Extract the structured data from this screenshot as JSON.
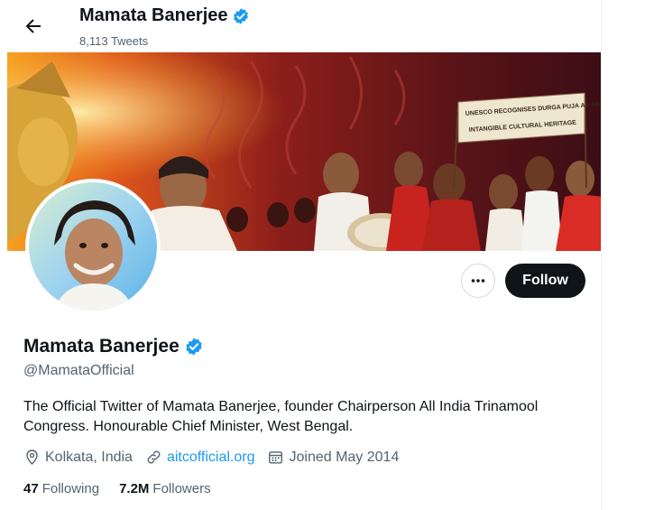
{
  "header": {
    "name": "Mamata Banerjee",
    "tweet_count": "8,113 Tweets"
  },
  "banner": {
    "sign_line1": "UNESCO RECOGNISES DURGA PUJA AS AN",
    "sign_line2": "INTANGIBLE CULTURAL HERITAGE"
  },
  "actions": {
    "follow_label": "Follow"
  },
  "profile": {
    "name": "Mamata Banerjee",
    "handle": "@MamataOfficial",
    "bio": "The Official Twitter of Mamata Banerjee, founder Chairperson All India Trinamool Congress. Honourable Chief Minister, West Bengal.",
    "location": "Kolkata, India",
    "website": "aitcofficial.org",
    "joined": "Joined May 2014"
  },
  "stats": {
    "following_count": "47",
    "following_label": "Following",
    "followers_count": "7.2M",
    "followers_label": "Followers"
  },
  "colors": {
    "accent": "#1d9bf0",
    "text": "#0f1419",
    "muted": "#536471",
    "button": "#0f1419"
  },
  "icons": [
    "back-arrow-icon",
    "verified-badge-icon",
    "more-icon",
    "location-icon",
    "link-icon",
    "calendar-icon"
  ]
}
